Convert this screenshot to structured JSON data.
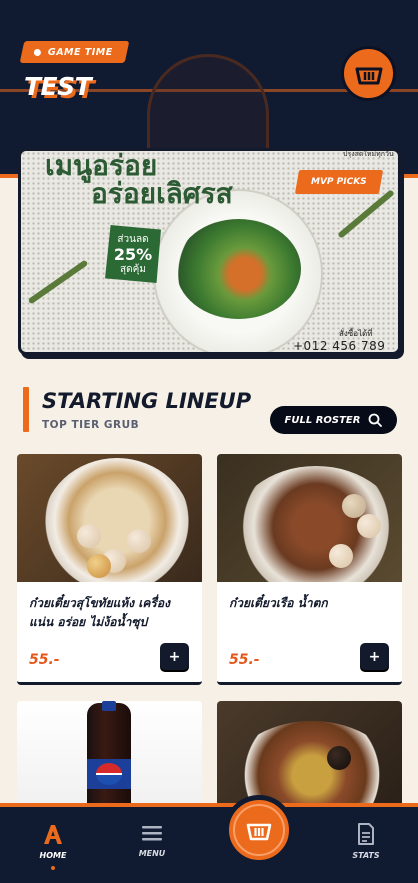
{
  "header": {
    "badge": "GAME TIME",
    "title": "TEST"
  },
  "banner": {
    "headline_line1": "เมนูอร่อย",
    "headline_line2": "อร่อยเลิศรส",
    "tagline": "ปรุงสดใหม่ทุกวัน",
    "discount_label": "ส่วนลด",
    "discount_value": "25%",
    "discount_sub": "สุดคุ้ม",
    "mvp_label": "MVP PICKS",
    "order_label": "สั่งซื้อได้ที่",
    "phone": "+012 456 789"
  },
  "section": {
    "title": "STARTING LINEUP",
    "subtitle": "TOP TIER GRUB",
    "roster_button": "FULL ROSTER"
  },
  "products": [
    {
      "name": "ก๋วยเตี๋ยวสุโขทัยแห้ง เครื่องแน่น อร่อย ไม่ง้อน้ำซุป",
      "price": "55.-",
      "add": "+"
    },
    {
      "name": "ก๋วยเตี๋ยวเรือ น้ำตก",
      "price": "55.-",
      "add": "+"
    },
    {
      "name": "Pepsi",
      "price": "",
      "add": "+"
    },
    {
      "name": "",
      "price": "",
      "add": "+"
    }
  ],
  "nav": {
    "home": "HOME",
    "menu": "MENU",
    "stats": "STATS"
  },
  "colors": {
    "navy": "#101a30",
    "accent": "#ec6a1c",
    "background": "#f6f0e6",
    "price": "#e4571a"
  },
  "icons": {
    "cart": "basket-icon",
    "home": "a-logo-icon",
    "menu": "hamburger-icon",
    "stats": "document-icon",
    "search": "search-icon"
  }
}
